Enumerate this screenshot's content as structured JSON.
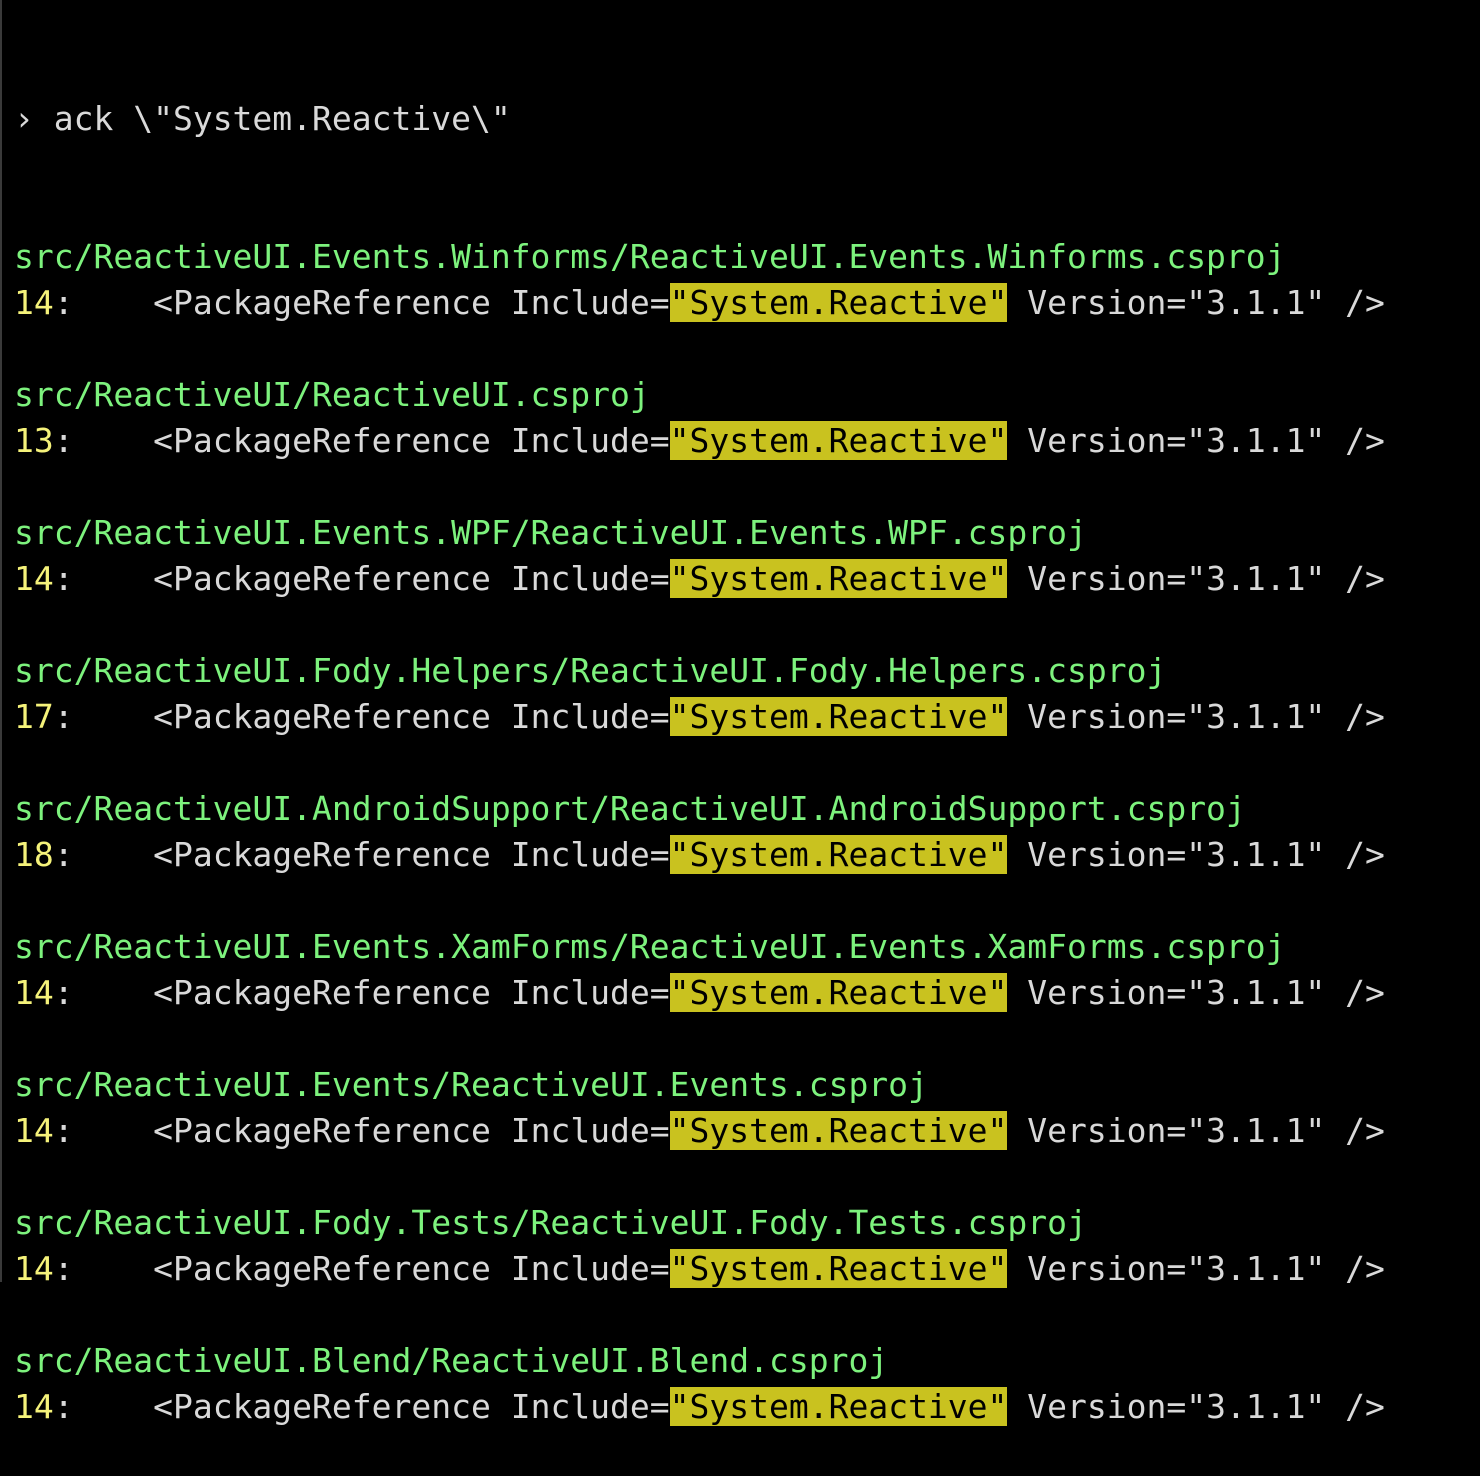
{
  "command": {
    "prompt": "›",
    "text": "ack \\\"System.Reactive\\\""
  },
  "results": [
    {
      "path": "src/ReactiveUI.Events.Winforms/ReactiveUI.Events.Winforms.csproj",
      "line": "14",
      "before": "    <PackageReference Include=",
      "match": "\"System.Reactive\"",
      "after": " Version=\"3.1.1\" />"
    },
    {
      "path": "src/ReactiveUI/ReactiveUI.csproj",
      "line": "13",
      "before": "    <PackageReference Include=",
      "match": "\"System.Reactive\"",
      "after": " Version=\"3.1.1\" />"
    },
    {
      "path": "src/ReactiveUI.Events.WPF/ReactiveUI.Events.WPF.csproj",
      "line": "14",
      "before": "    <PackageReference Include=",
      "match": "\"System.Reactive\"",
      "after": " Version=\"3.1.1\" />"
    },
    {
      "path": "src/ReactiveUI.Fody.Helpers/ReactiveUI.Fody.Helpers.csproj",
      "line": "17",
      "before": "    <PackageReference Include=",
      "match": "\"System.Reactive\"",
      "after": " Version=\"3.1.1\" />"
    },
    {
      "path": "src/ReactiveUI.AndroidSupport/ReactiveUI.AndroidSupport.csproj",
      "line": "18",
      "before": "    <PackageReference Include=",
      "match": "\"System.Reactive\"",
      "after": " Version=\"3.1.1\" />"
    },
    {
      "path": "src/ReactiveUI.Events.XamForms/ReactiveUI.Events.XamForms.csproj",
      "line": "14",
      "before": "    <PackageReference Include=",
      "match": "\"System.Reactive\"",
      "after": " Version=\"3.1.1\" />"
    },
    {
      "path": "src/ReactiveUI.Events/ReactiveUI.Events.csproj",
      "line": "14",
      "before": "    <PackageReference Include=",
      "match": "\"System.Reactive\"",
      "after": " Version=\"3.1.1\" />"
    },
    {
      "path": "src/ReactiveUI.Fody.Tests/ReactiveUI.Fody.Tests.csproj",
      "line": "14",
      "before": "    <PackageReference Include=",
      "match": "\"System.Reactive\"",
      "after": " Version=\"3.1.1\" />"
    },
    {
      "path": "src/ReactiveUI.Blend/ReactiveUI.Blend.csproj",
      "line": "14",
      "before": "    <PackageReference Include=",
      "match": "\"System.Reactive\"",
      "after": " Version=\"3.1.1\" />"
    }
  ],
  "colors": {
    "background": "#000000",
    "path": "#7df27d",
    "line_number": "#f5f27a",
    "match_highlight": "#c9c21f",
    "text": "#d9d9d9"
  }
}
